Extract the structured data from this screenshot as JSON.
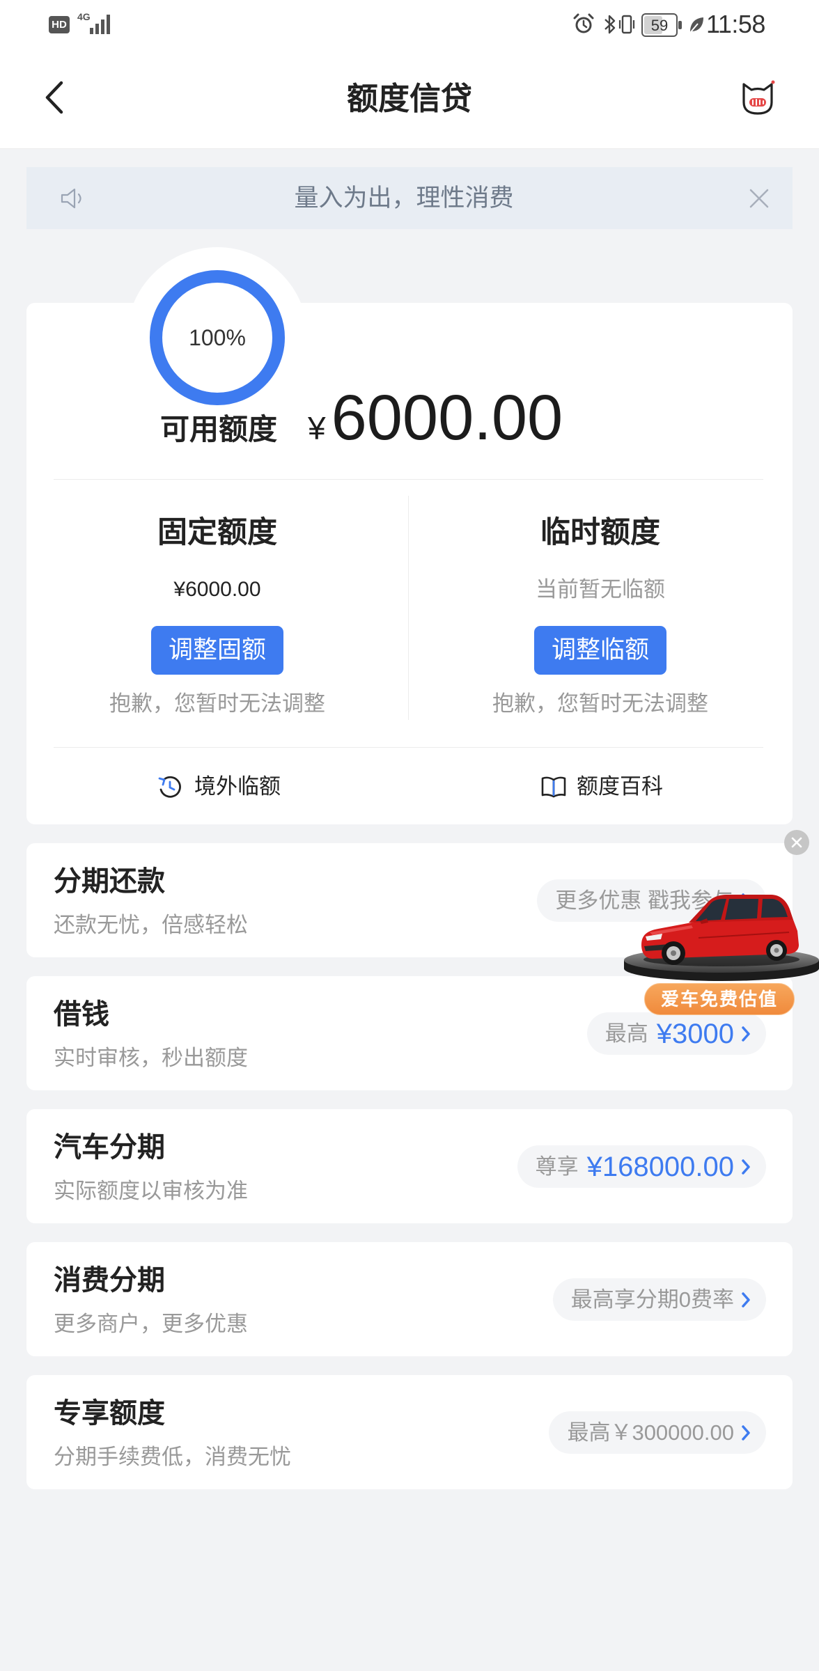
{
  "status_bar": {
    "hd_label": "HD",
    "network_type": "4G",
    "battery_level": "59",
    "time": "11:58"
  },
  "header": {
    "title": "额度信贷"
  },
  "notice": {
    "text": "量入为出，理性消费"
  },
  "credit": {
    "usage_percent": 100,
    "usage_label": "100%",
    "available_label": "可用额度",
    "currency_symbol": "¥",
    "available_amount": "6000.00",
    "fixed": {
      "title": "固定额度",
      "value": "¥6000.00",
      "button_label": "调整固额",
      "note": "抱歉，您暂时无法调整"
    },
    "temporary": {
      "title": "临时额度",
      "value": "当前暂无临额",
      "button_label": "调整临额",
      "note": "抱歉，您暂时无法调整"
    },
    "links": [
      {
        "label": "境外临额",
        "icon": "clock-arrow-icon"
      },
      {
        "label": "额度百科",
        "icon": "book-icon"
      }
    ]
  },
  "services": [
    {
      "title": "分期还款",
      "subtitle": "还款无忧，倍感轻松",
      "pill_text": "更多优惠 戳我参与"
    },
    {
      "title": "借钱",
      "subtitle": "实时审核，秒出额度",
      "pill_text": "最高",
      "pill_value": "¥3000"
    },
    {
      "title": "汽车分期",
      "subtitle": "实际额度以审核为准",
      "pill_text": "尊享",
      "pill_value": "¥168000.00"
    },
    {
      "title": "消费分期",
      "subtitle": "更多商户，更多优惠",
      "pill_text": "最高享分期0费率"
    },
    {
      "title": "专享额度",
      "subtitle": "分期手续费低，消费无忧",
      "pill_text": "最高￥300000.00"
    }
  ],
  "car_ad": {
    "label": "爱车免费估值"
  },
  "icons": {
    "back": "chevron-left-icon",
    "customer_service": "cat-mascot-icon",
    "notice": "speaker-icon",
    "notice_close": "close-icon",
    "pill_arrow": "chevron-right-icon",
    "ad_close": "close-circle-icon"
  },
  "colors": {
    "accent": "#3e7bf0",
    "page_bg": "#f2f3f5",
    "notice_bg": "#e8edf3",
    "pill_bg": "#f4f5f7",
    "ad_orange": "#f08a3c",
    "car_red": "#d61c1c"
  }
}
